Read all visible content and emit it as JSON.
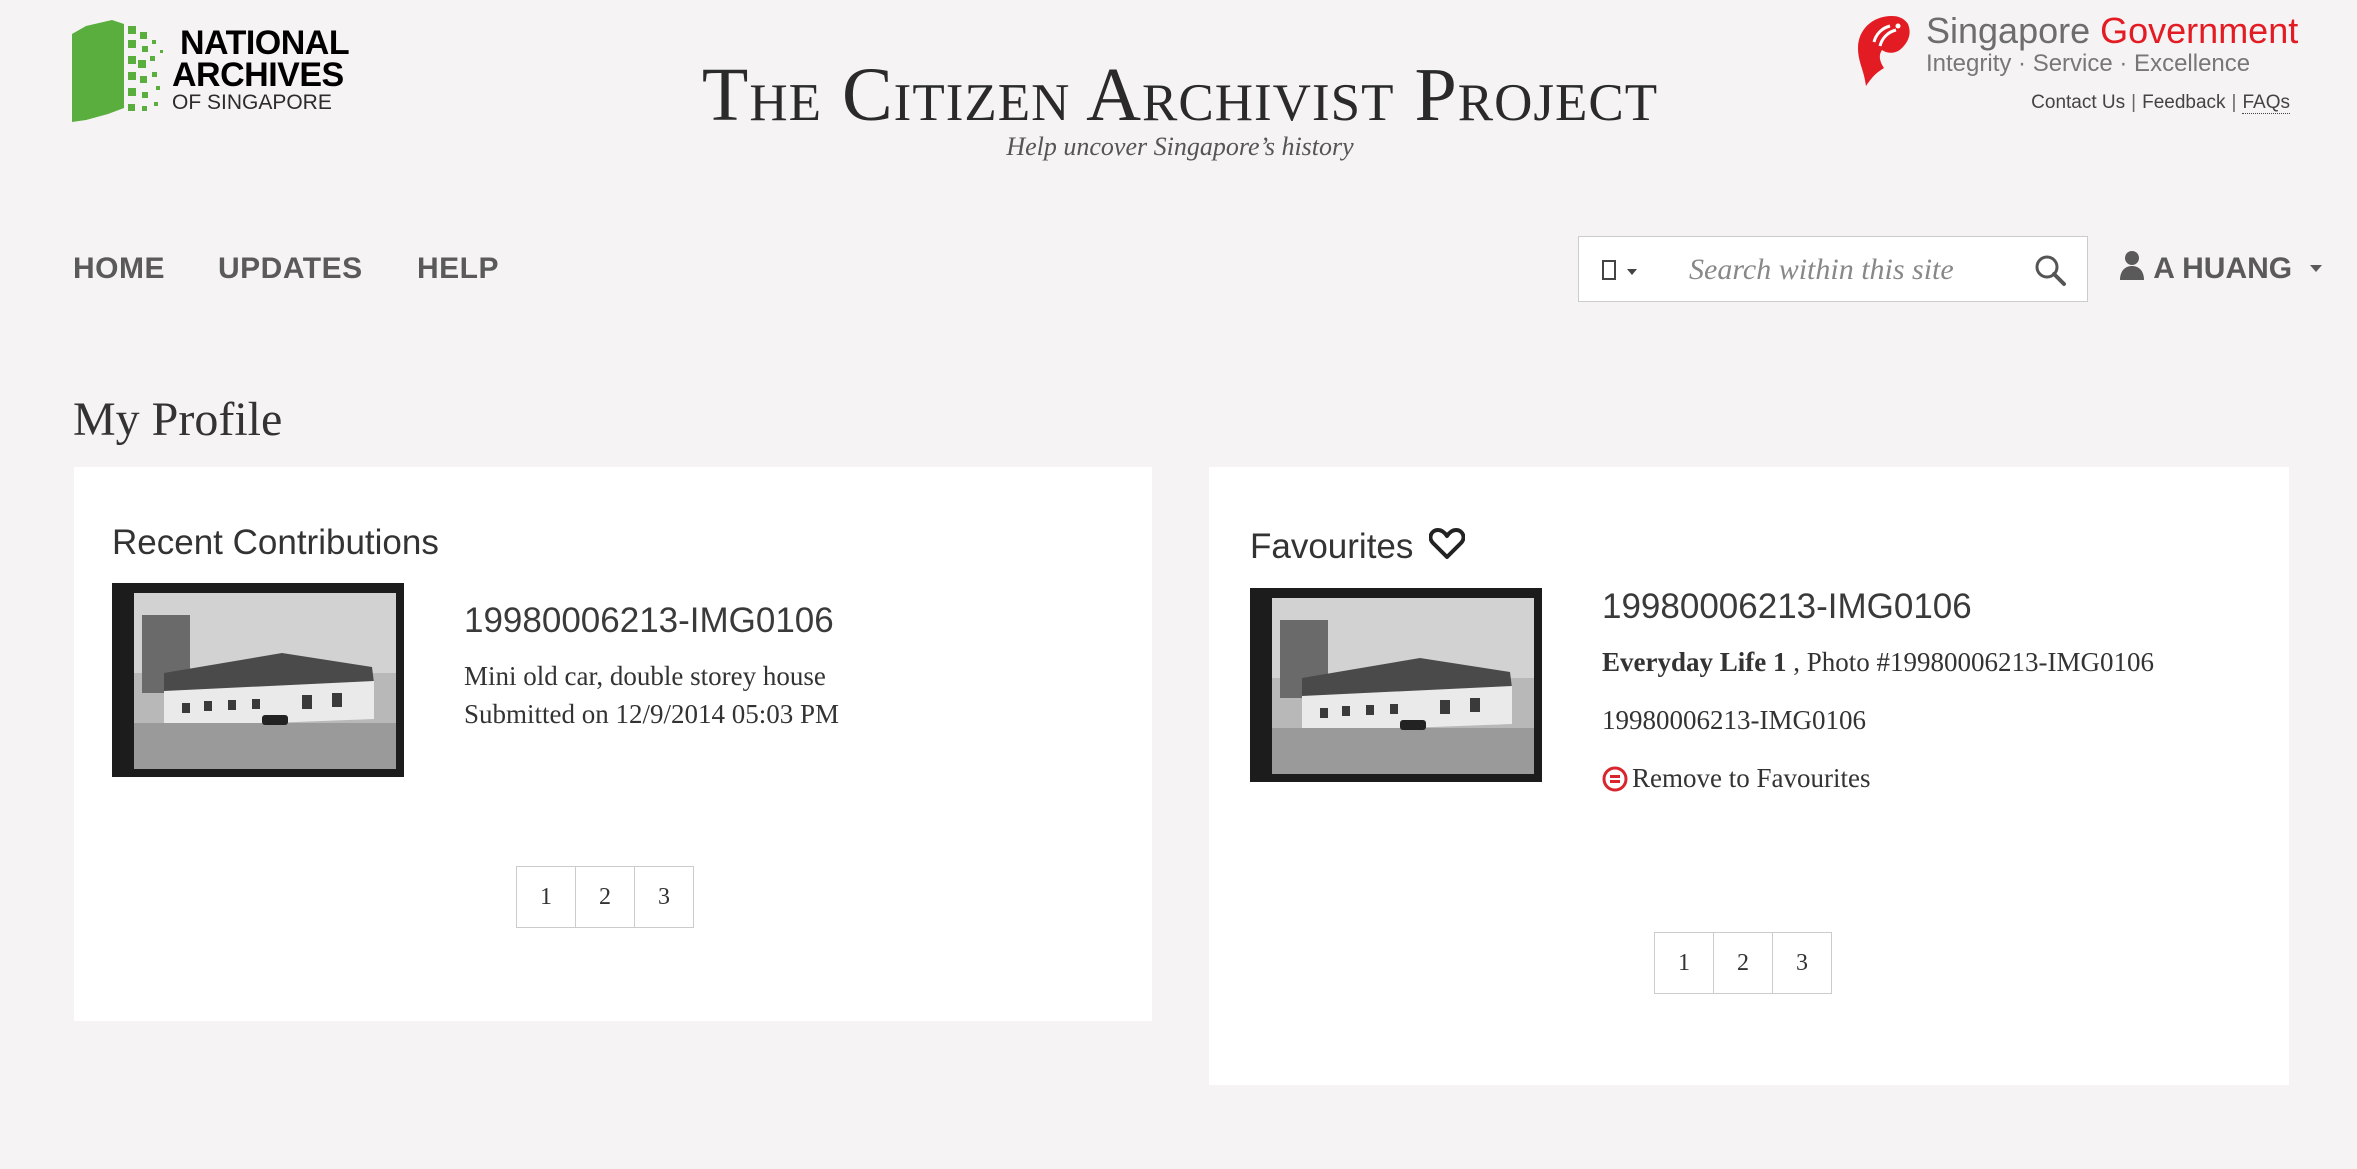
{
  "brand": {
    "nas_line1": "NATIONAL",
    "nas_line2": "ARCHIVES",
    "nas_line3": "OF SINGAPORE",
    "brand_green": "#5aae3e"
  },
  "header": {
    "title": "The Citizen Archivist Project",
    "tagline": "Help uncover Singapore’s history"
  },
  "gov": {
    "name_part1": "Singapore ",
    "name_part2": "Government",
    "motto": "Integrity · Service · Excellence",
    "links": [
      "Contact Us",
      "Feedback",
      "FAQs"
    ],
    "red": "#e31b23"
  },
  "nav": {
    "items": [
      "HOME",
      "UPDATES",
      "HELP"
    ]
  },
  "search": {
    "placeholder": "Search within this site",
    "scope_icon": "square-icon",
    "button_icon": "search-icon"
  },
  "user": {
    "name": "A HUANG",
    "icon": "user-icon"
  },
  "page": {
    "title": "My Profile"
  },
  "recent": {
    "heading": "Recent Contributions",
    "item": {
      "id": "19980006213-IMG0106",
      "description": "Mini old car, double storey house",
      "submitted": "Submitted on 12/9/2014 05:03 PM"
    },
    "pages": [
      "1",
      "2",
      "3"
    ]
  },
  "favourites": {
    "heading": "Favourites",
    "heading_icon": "heart-icon",
    "item": {
      "id": "19980006213-IMG0106",
      "collection": "Everyday Life 1",
      "photo_ref": " , Photo #19980006213-IMG0106",
      "ref": "19980006213-IMG0106",
      "remove_label": "Remove to Favourites",
      "remove_icon": "remove-icon"
    },
    "pages": [
      "1",
      "2",
      "3"
    ]
  }
}
